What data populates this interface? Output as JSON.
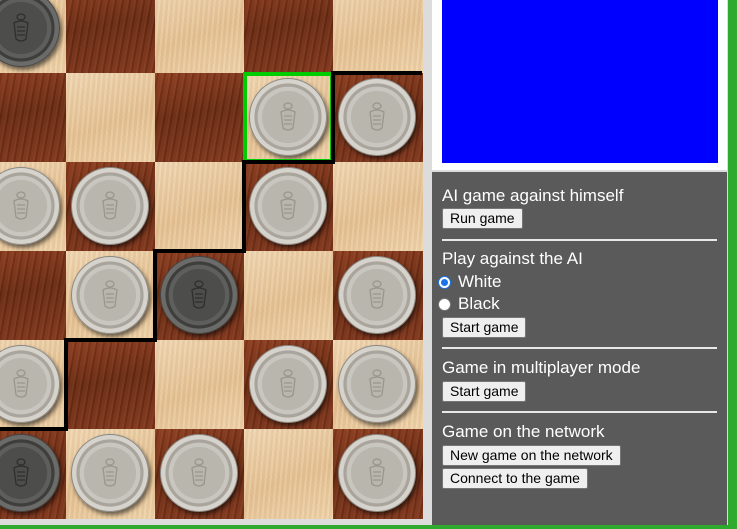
{
  "board": {
    "light_color": "#e9c9a0",
    "dark_color": "#7a3216",
    "highlight_color": "#00cc00",
    "region_line_color": "#000000",
    "pieces": [
      {
        "row": 0,
        "col": 0,
        "color": "black"
      },
      {
        "row": 1,
        "col": 3,
        "color": "white"
      },
      {
        "row": 1,
        "col": 4,
        "color": "white"
      },
      {
        "row": 2,
        "col": 0,
        "color": "white"
      },
      {
        "row": 2,
        "col": 1,
        "color": "white"
      },
      {
        "row": 2,
        "col": 3,
        "color": "white"
      },
      {
        "row": 3,
        "col": 1,
        "color": "white"
      },
      {
        "row": 3,
        "col": 2,
        "color": "black"
      },
      {
        "row": 3,
        "col": 4,
        "color": "white"
      },
      {
        "row": 4,
        "col": 0,
        "color": "white"
      },
      {
        "row": 4,
        "col": 3,
        "color": "white"
      },
      {
        "row": 4,
        "col": 4,
        "color": "white"
      },
      {
        "row": 5,
        "col": 0,
        "color": "black"
      },
      {
        "row": 5,
        "col": 1,
        "color": "white"
      },
      {
        "row": 5,
        "col": 2,
        "color": "white"
      },
      {
        "row": 5,
        "col": 4,
        "color": "white"
      }
    ],
    "selected": {
      "row": 1,
      "col": 3
    }
  },
  "panel": {
    "canvas_color": "#0000ff",
    "ai_self": {
      "title": "AI game against himself",
      "button": "Run game"
    },
    "vs_ai": {
      "title": "Play against the AI",
      "options": [
        {
          "label": "White",
          "checked": true
        },
        {
          "label": "Black",
          "checked": false
        }
      ],
      "button": "Start game"
    },
    "multiplayer": {
      "title": "Game in multiplayer mode",
      "button": "Start game"
    },
    "network": {
      "title": "Game on the network",
      "new_button": "New game on the network",
      "connect_button": "Connect to the game"
    }
  }
}
